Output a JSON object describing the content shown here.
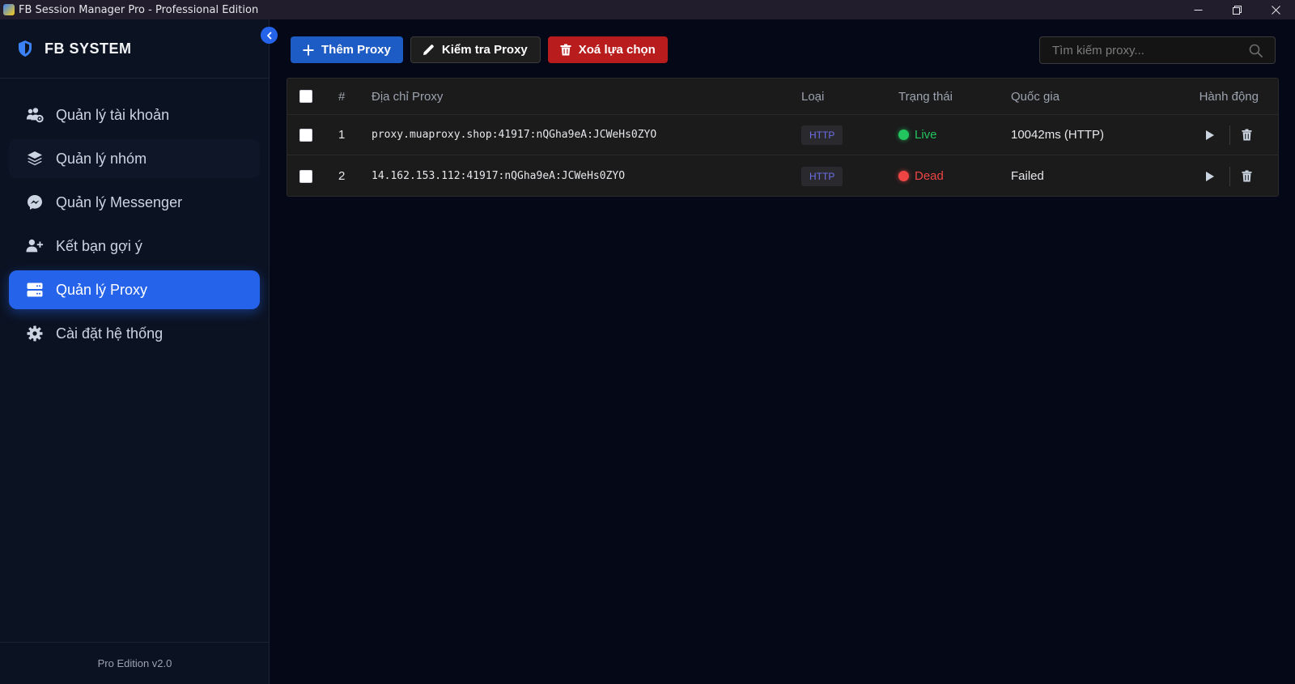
{
  "window": {
    "title": "FB Session Manager Pro - Professional Edition"
  },
  "sidebar": {
    "brand": "FB SYSTEM",
    "items": [
      {
        "label": "Quản lý tài khoản",
        "icon": "users-cog-icon"
      },
      {
        "label": "Quản lý nhóm",
        "icon": "layers-icon"
      },
      {
        "label": "Quản lý Messenger",
        "icon": "messenger-icon"
      },
      {
        "label": "Kết bạn gợi ý",
        "icon": "user-plus-icon"
      },
      {
        "label": "Quản lý Proxy",
        "icon": "server-icon",
        "active": true
      },
      {
        "label": "Cài đặt hệ thống",
        "icon": "gear-icon"
      }
    ],
    "footer": "Pro Edition v2.0"
  },
  "toolbar": {
    "add_label": "Thêm Proxy",
    "check_label": "Kiểm tra Proxy",
    "delete_label": "Xoá lựa chọn"
  },
  "search": {
    "placeholder": "Tìm kiếm proxy..."
  },
  "table": {
    "columns": [
      "#",
      "Địa chỉ Proxy",
      "Loại",
      "Trạng thái",
      "Quốc gia",
      "Hành động"
    ],
    "rows": [
      {
        "index": "1",
        "address": "proxy.muaproxy.shop:41917:nQGha9eA:JCWeHs0ZYO",
        "type": "HTTP",
        "status": "Live",
        "country": "10042ms (HTTP)"
      },
      {
        "index": "2",
        "address": "14.162.153.112:41917:nQGha9eA:JCWeHs0ZYO",
        "type": "HTTP",
        "status": "Dead",
        "country": "Failed"
      }
    ]
  },
  "colors": {
    "accent": "#2563eb",
    "live": "#22c55e",
    "dead": "#ef4444",
    "danger": "#b91c1c"
  }
}
